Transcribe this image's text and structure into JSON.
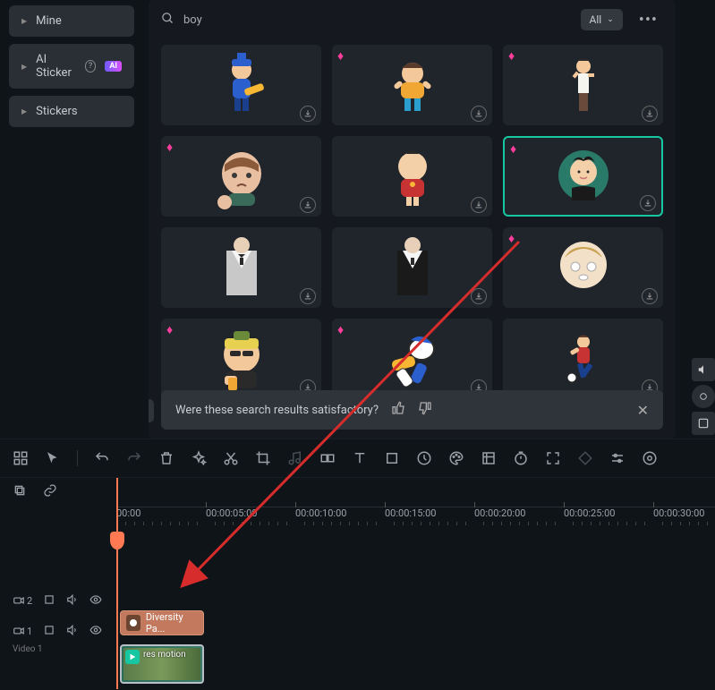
{
  "sidebar": {
    "items": [
      {
        "label": "Mine"
      },
      {
        "label": "AI Sticker",
        "ai_badge": "AI"
      },
      {
        "label": "Stickers"
      }
    ]
  },
  "search": {
    "query": "boy"
  },
  "filter": {
    "label": "All"
  },
  "feedback": {
    "text": "Were these search results satisfactory?"
  },
  "ruler": {
    "marks": [
      "00:00",
      "00:00:05:00",
      "00:00:10:00",
      "00:00:15:00",
      "00:00:20:00",
      "00:00:25:00",
      "00:00:30:00"
    ]
  },
  "tracks": {
    "t1_num": "2",
    "t2_num": "1",
    "video_label": "Video 1"
  },
  "clips": {
    "sticker": "Diversity Pa...",
    "video": "res motion"
  },
  "tiles": [
    {
      "gem": false
    },
    {
      "gem": true
    },
    {
      "gem": true
    },
    {
      "gem": true
    },
    {
      "gem": false
    },
    {
      "gem": true,
      "selected": true
    },
    {
      "gem": false
    },
    {
      "gem": false
    },
    {
      "gem": true
    },
    {
      "gem": true
    },
    {
      "gem": true
    },
    {
      "gem": false
    }
  ]
}
